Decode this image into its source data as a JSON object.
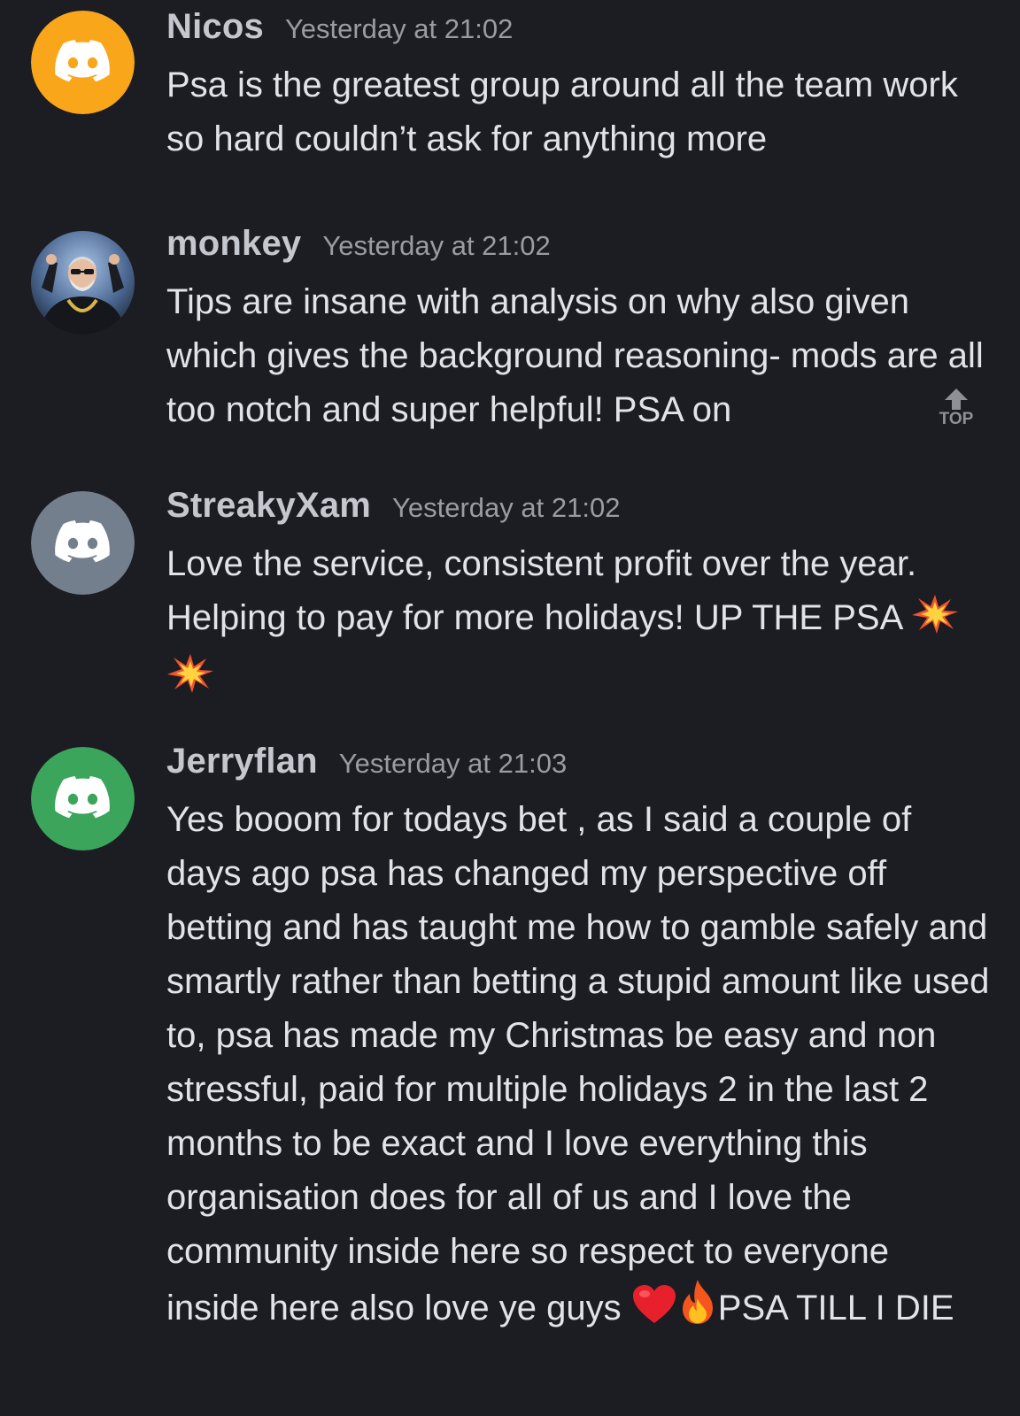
{
  "messages": [
    {
      "username": "Nicos",
      "username_color": "#c4c7cd",
      "timestamp": "Yesterday at 21:02",
      "avatar": {
        "type": "discord-logo",
        "color": "#faa61a"
      },
      "text": "Psa is the greatest group around all the team work so hard couldn’t ask for anything more"
    },
    {
      "username": "monkey",
      "username_color": "#c4c7cd",
      "timestamp": "Yesterday at 21:02",
      "avatar": {
        "type": "photo",
        "color": "#3a4a66"
      },
      "text": "Tips are insane with analysis on why also given which gives the background reasoning- mods are all too notch and super helpful! PSA on"
    },
    {
      "username": "StreakyXam",
      "username_color": "#c4c7cd",
      "timestamp": "Yesterday at 21:02",
      "avatar": {
        "type": "discord-logo",
        "color": "#747f8d"
      },
      "text": "Love the service, consistent profit over the year. Helping to pay for more holidays! UP THE PSA",
      "emoji": [
        "collision-icon",
        "collision-icon"
      ]
    },
    {
      "username": "Jerryflan",
      "username_color": "#c4c7cd",
      "timestamp": "Yesterday at 21:03",
      "avatar": {
        "type": "discord-logo",
        "color": "#3ba55c"
      },
      "text": "Yes booom for todays bet , as I said a couple of days ago psa has changed my perspective off betting and has taught me how to gamble safely and smartly rather than betting a stupid amount like used to, psa has made my Christmas be easy and non stressful, paid for multiple holidays 2 in the last 2 months to be exact and I love everything this organisation does for all of us and I love the community inside here so respect to everyone inside here also love ye guys",
      "emoji": [
        "red-heart-icon",
        "fire-icon"
      ],
      "text_after_emoji": "PSA TILL I DIE"
    }
  ],
  "scroll_top": {
    "label": "TOP",
    "icon": "arrow-up-icon"
  }
}
